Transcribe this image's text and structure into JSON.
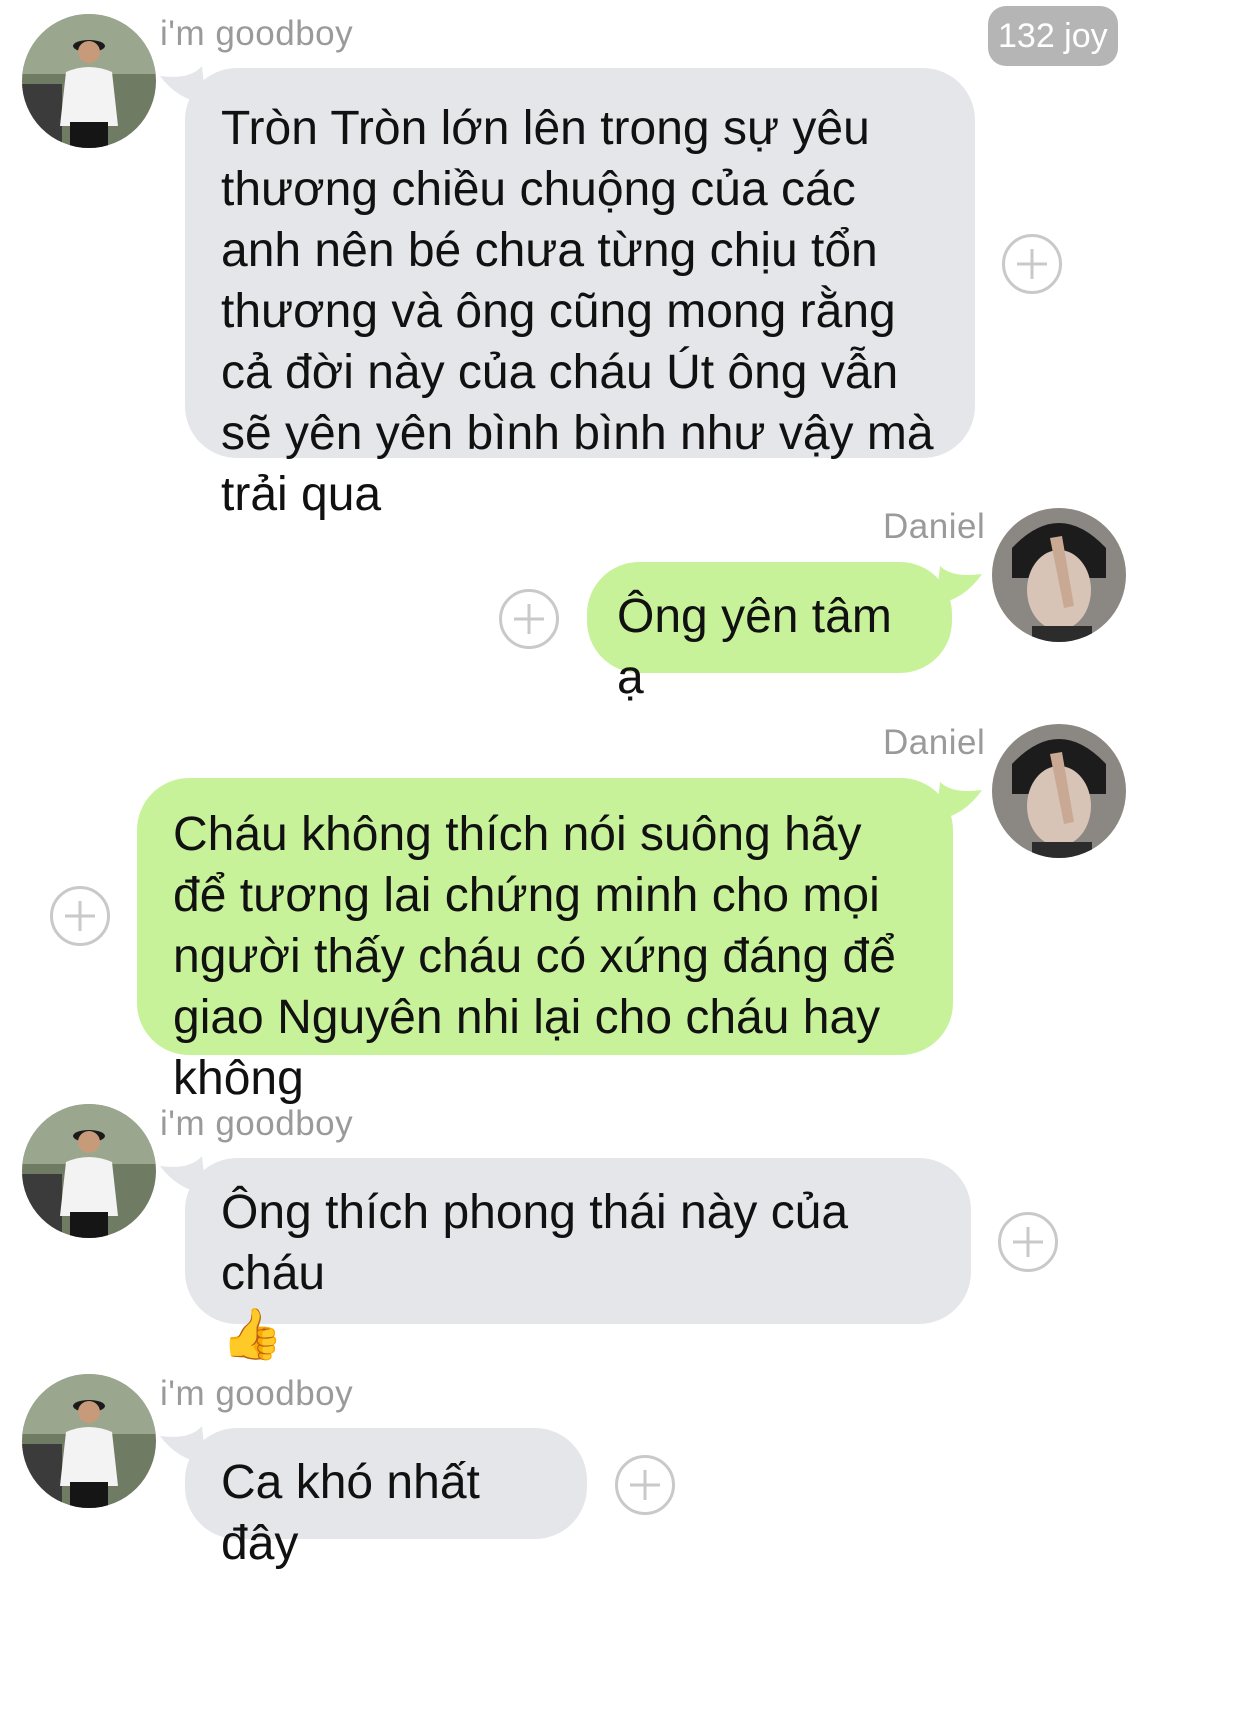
{
  "badge": {
    "joy": "132 joy"
  },
  "messages": [
    {
      "sender": "i'm goodboy",
      "text": "Tròn Tròn lớn lên trong sự yêu thương chiều chuộng của các anh nên bé chưa từng chịu tổn thương và ông cũng mong rằng cả đời này của cháu Út ông vẫn sẽ yên yên bình bình như vậy mà trải qua"
    },
    {
      "sender": "Daniel",
      "text": "Ông yên tâm ạ"
    },
    {
      "sender": "Daniel",
      "text": "Cháu không thích nói suông hãy để tương lai chứng minh cho mọi người thấy cháu có xứng đáng để giao Nguyên nhi lại cho cháu hay không"
    },
    {
      "sender": "i'm goodboy",
      "text": "Ông thích phong thái này của cháu",
      "emoji": "👍"
    },
    {
      "sender": "i'm goodboy",
      "text": "Ca khó nhất đây"
    }
  ],
  "colors": {
    "incoming_bubble": "#e5e6ea",
    "outgoing_bubble": "#c8f29a",
    "name_text": "#9a9a9a"
  },
  "icons": {
    "add": "plus-circle-icon",
    "reaction_emoji": "thumbs-up"
  }
}
